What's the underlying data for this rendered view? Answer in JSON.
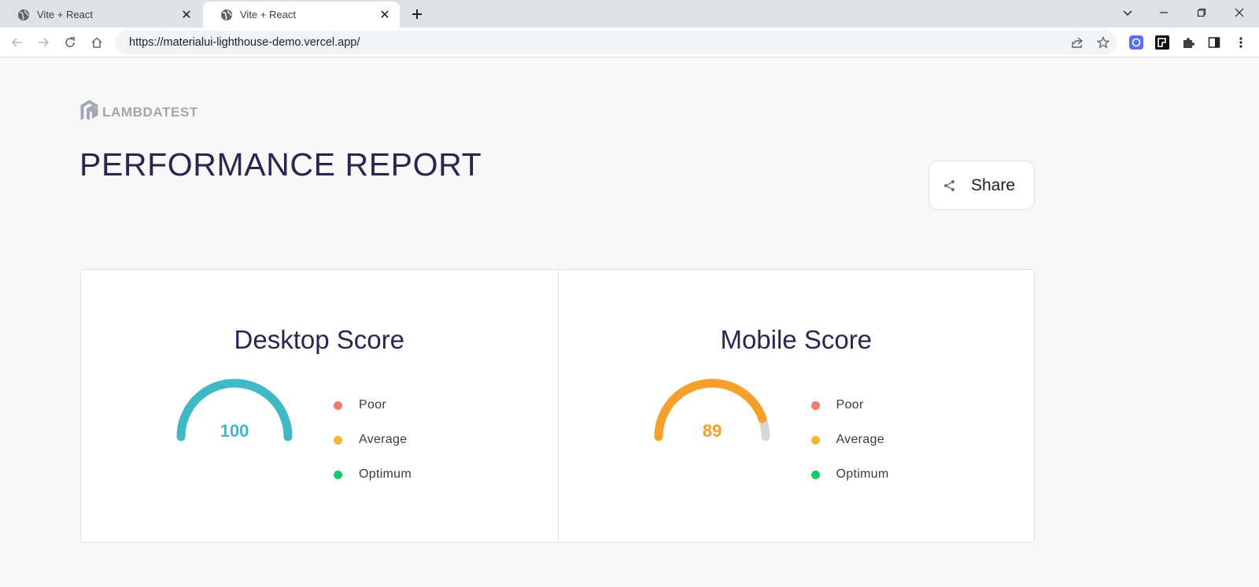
{
  "browser": {
    "tabs": [
      {
        "title": "Vite + React",
        "active": false
      },
      {
        "title": "Vite + React",
        "active": true
      }
    ],
    "url": "https://materialui-lighthouse-demo.vercel.app/"
  },
  "page": {
    "logo_text": "LAMBDATEST",
    "title": "PERFORMANCE REPORT",
    "share_label": "Share"
  },
  "scores": [
    {
      "title": "Desktop Score",
      "value": "100",
      "fraction": 1.0,
      "color": "#3eb9c5"
    },
    {
      "title": "Mobile Score",
      "value": "89",
      "fraction": 0.89,
      "color": "#f79f2b"
    }
  ],
  "legend": [
    {
      "label": "Poor",
      "color": "#ef7b6b"
    },
    {
      "label": "Average",
      "color": "#f5b52e"
    },
    {
      "label": "Optimum",
      "color": "#18c96b"
    }
  ],
  "colors": {
    "track": "#d6d6d6",
    "title_text": "#2b2650"
  }
}
